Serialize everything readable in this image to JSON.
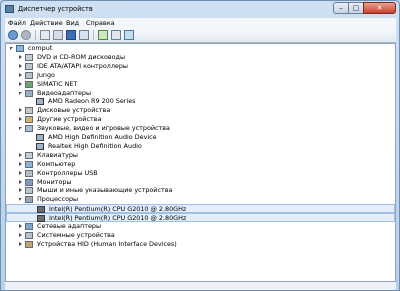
{
  "window": {
    "title": "Диспетчер устройств"
  },
  "titlebar": {
    "min": "–",
    "max": "□",
    "close": "✕"
  },
  "menu": [
    "Файл",
    "Действие",
    "Вид",
    "Справка"
  ],
  "toolbar": {
    "icons": [
      "back-icon",
      "forward-icon",
      "properties-icon",
      "help-icon",
      "update-driver-icon",
      "scan-icon",
      "uninstall-icon",
      "disable-icon"
    ]
  },
  "tree": {
    "root": "comput",
    "categories": [
      {
        "label": "DVD и CD-ROM дисководы",
        "expanded": false
      },
      {
        "label": "IDE ATA/ATAPI контроллеры",
        "expanded": false
      },
      {
        "label": "Jungo",
        "expanded": false
      },
      {
        "label": "SIMATIC NET",
        "expanded": false
      },
      {
        "label": "Видеоадаптеры",
        "expanded": true,
        "children": [
          "AMD Radeon R9 200 Series"
        ]
      },
      {
        "label": "Дисковые устройства",
        "expanded": false
      },
      {
        "label": "Другие устройства",
        "expanded": false
      },
      {
        "label": "Звуковые, видео и игровые устройства",
        "expanded": true,
        "children": [
          "AMD High Definition Audio Device",
          "Realtek High Definition Audio"
        ]
      },
      {
        "label": "Клавиатуры",
        "expanded": false
      },
      {
        "label": "Компьютер",
        "expanded": false
      },
      {
        "label": "Контроллеры USB",
        "expanded": false
      },
      {
        "label": "Мониторы",
        "expanded": false
      },
      {
        "label": "Мыши и иные указывающие устройства",
        "expanded": false
      },
      {
        "label": "Процессоры",
        "expanded": true,
        "children": [
          "Intel(R) Pentium(R) CPU G2010 @ 2.80GHz",
          "Intel(R) Pentium(R) CPU G2010 @ 2.80GHz"
        ]
      },
      {
        "label": "Сетевые адаптеры",
        "expanded": false
      },
      {
        "label": "Системные устройства",
        "expanded": false
      },
      {
        "label": "Устройства HID (Human Interface Devices)",
        "expanded": false
      }
    ]
  }
}
